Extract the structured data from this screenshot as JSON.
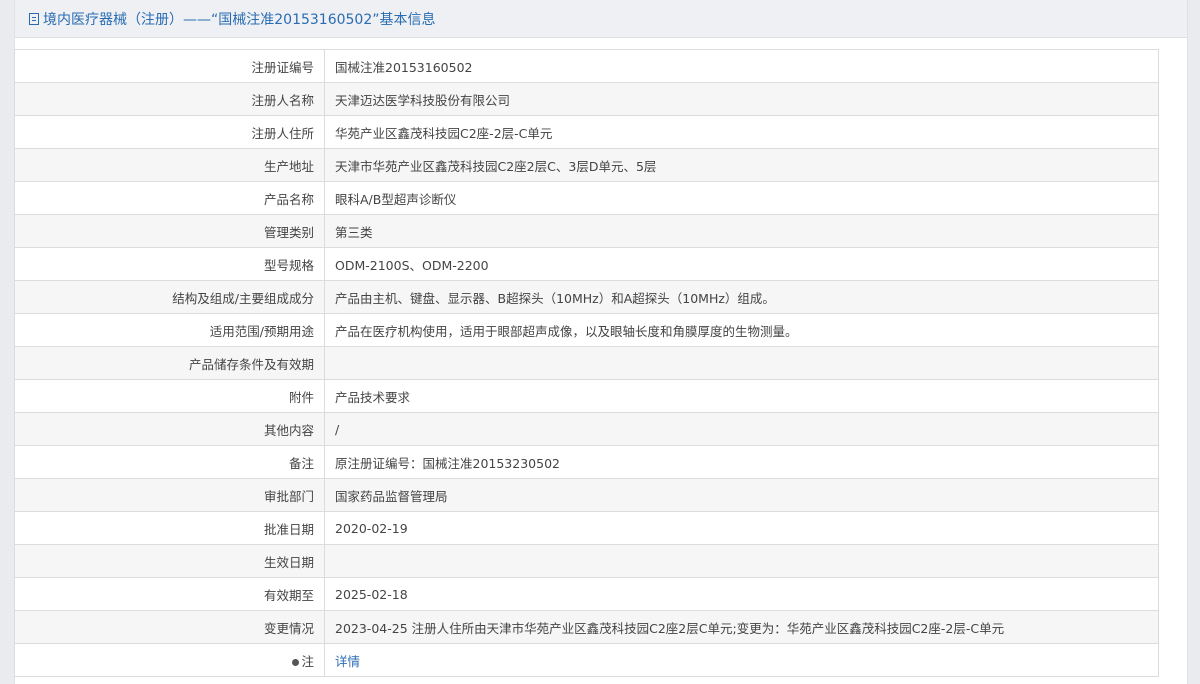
{
  "header": {
    "title": "境内医疗器械（注册）——“国械注准20153160502”基本信息",
    "accent": "#2a6cb3"
  },
  "rows": [
    {
      "label": "注册证编号",
      "value": "国械注准20153160502"
    },
    {
      "label": "注册人名称",
      "value": "天津迈达医学科技股份有限公司"
    },
    {
      "label": "注册人住所",
      "value": "华苑产业区鑫茂科技园C2座-2层-C单元"
    },
    {
      "label": "生产地址",
      "value": "天津市华苑产业区鑫茂科技园C2座2层C、3层D单元、5层"
    },
    {
      "label": "产品名称",
      "value": "眼科A/B型超声诊断仪"
    },
    {
      "label": "管理类别",
      "value": "第三类"
    },
    {
      "label": "型号规格",
      "value": "ODM-2100S、ODM-2200"
    },
    {
      "label": "结构及组成/主要组成成分",
      "value": "产品由主机、键盘、显示器、B超探头（10MHz）和A超探头（10MHz）组成。"
    },
    {
      "label": "适用范围/预期用途",
      "value": "产品在医疗机构使用，适用于眼部超声成像，以及眼轴长度和角膜厚度的生物测量。"
    },
    {
      "label": "产品储存条件及有效期",
      "value": ""
    },
    {
      "label": "附件",
      "value": "产品技术要求"
    },
    {
      "label": "其他内容",
      "value": "/"
    },
    {
      "label": "备注",
      "value": "原注册证编号：国械注准20153230502"
    },
    {
      "label": "审批部门",
      "value": "国家药品监督管理局"
    },
    {
      "label": "批准日期",
      "value": "2020-02-19"
    },
    {
      "label": "生效日期",
      "value": ""
    },
    {
      "label": "有效期至",
      "value": "2025-02-18"
    },
    {
      "label": "变更情况",
      "value": "2023-04-25 注册人住所由天津市华苑产业区鑫茂科技园C2座2层C单元;变更为：华苑产业区鑫茂科技园C2座-2层-C单元"
    }
  ],
  "note_row": {
    "label": "注",
    "link": "详情",
    "icon": "pin-icon"
  }
}
